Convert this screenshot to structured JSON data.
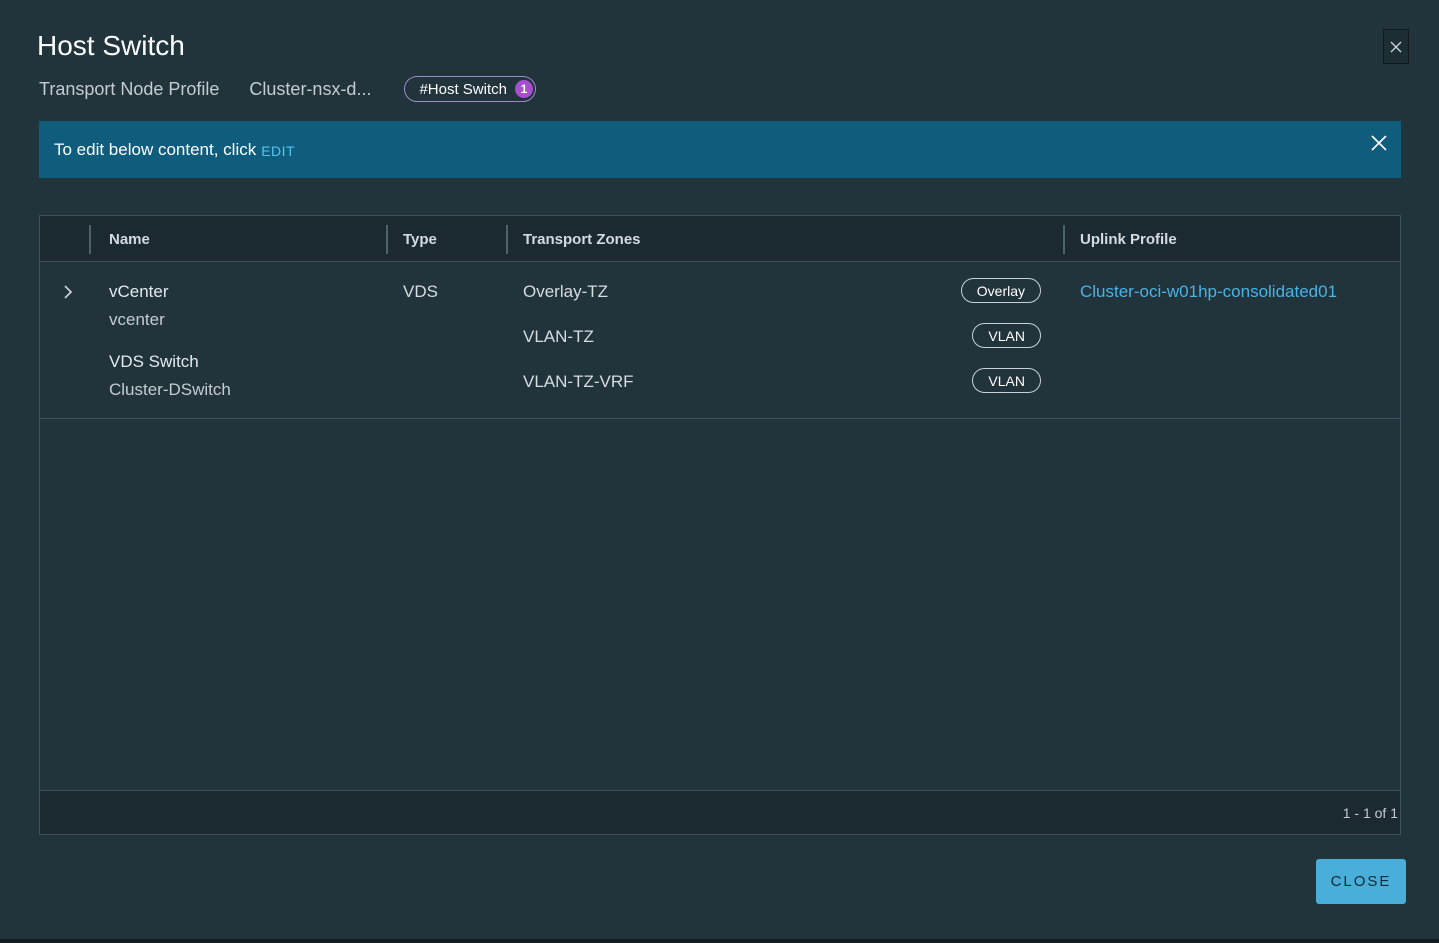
{
  "dialog": {
    "title": "Host Switch",
    "close_label": "CLOSE"
  },
  "breadcrumb": {
    "items": [
      "Transport Node Profile",
      "Cluster-nsx-d..."
    ],
    "chip_label": "#Host Switch",
    "chip_count": "1"
  },
  "banner": {
    "text": "To edit below content, click",
    "link": "EDIT"
  },
  "grid": {
    "columns": [
      "Name",
      "Type",
      "Transport Zones",
      "Uplink Profile"
    ],
    "rows": [
      {
        "name_label": "vCenter",
        "name_value": "vcenter",
        "switch_label": "VDS Switch",
        "switch_value": "Cluster-DSwitch",
        "type": "VDS",
        "transport_zones": [
          {
            "name": "Overlay-TZ",
            "kind": "Overlay"
          },
          {
            "name": "VLAN-TZ",
            "kind": "VLAN"
          },
          {
            "name": "VLAN-TZ-VRF",
            "kind": "VLAN"
          }
        ],
        "uplink_profile": "Cluster-oci-w01hp-consolidated01"
      }
    ],
    "pagination": "1 - 1 of 1"
  },
  "icons": {
    "dialog_close": "close-icon",
    "banner_close": "close-icon",
    "row_expand": "chevron-right-icon"
  },
  "colors": {
    "background": "#21333b",
    "banner": "#0f5c7d",
    "accent": "#49afd9",
    "chip_border": "#9d8ac9",
    "chip_badge": "#a84ed1",
    "link": "#49b3e5"
  }
}
